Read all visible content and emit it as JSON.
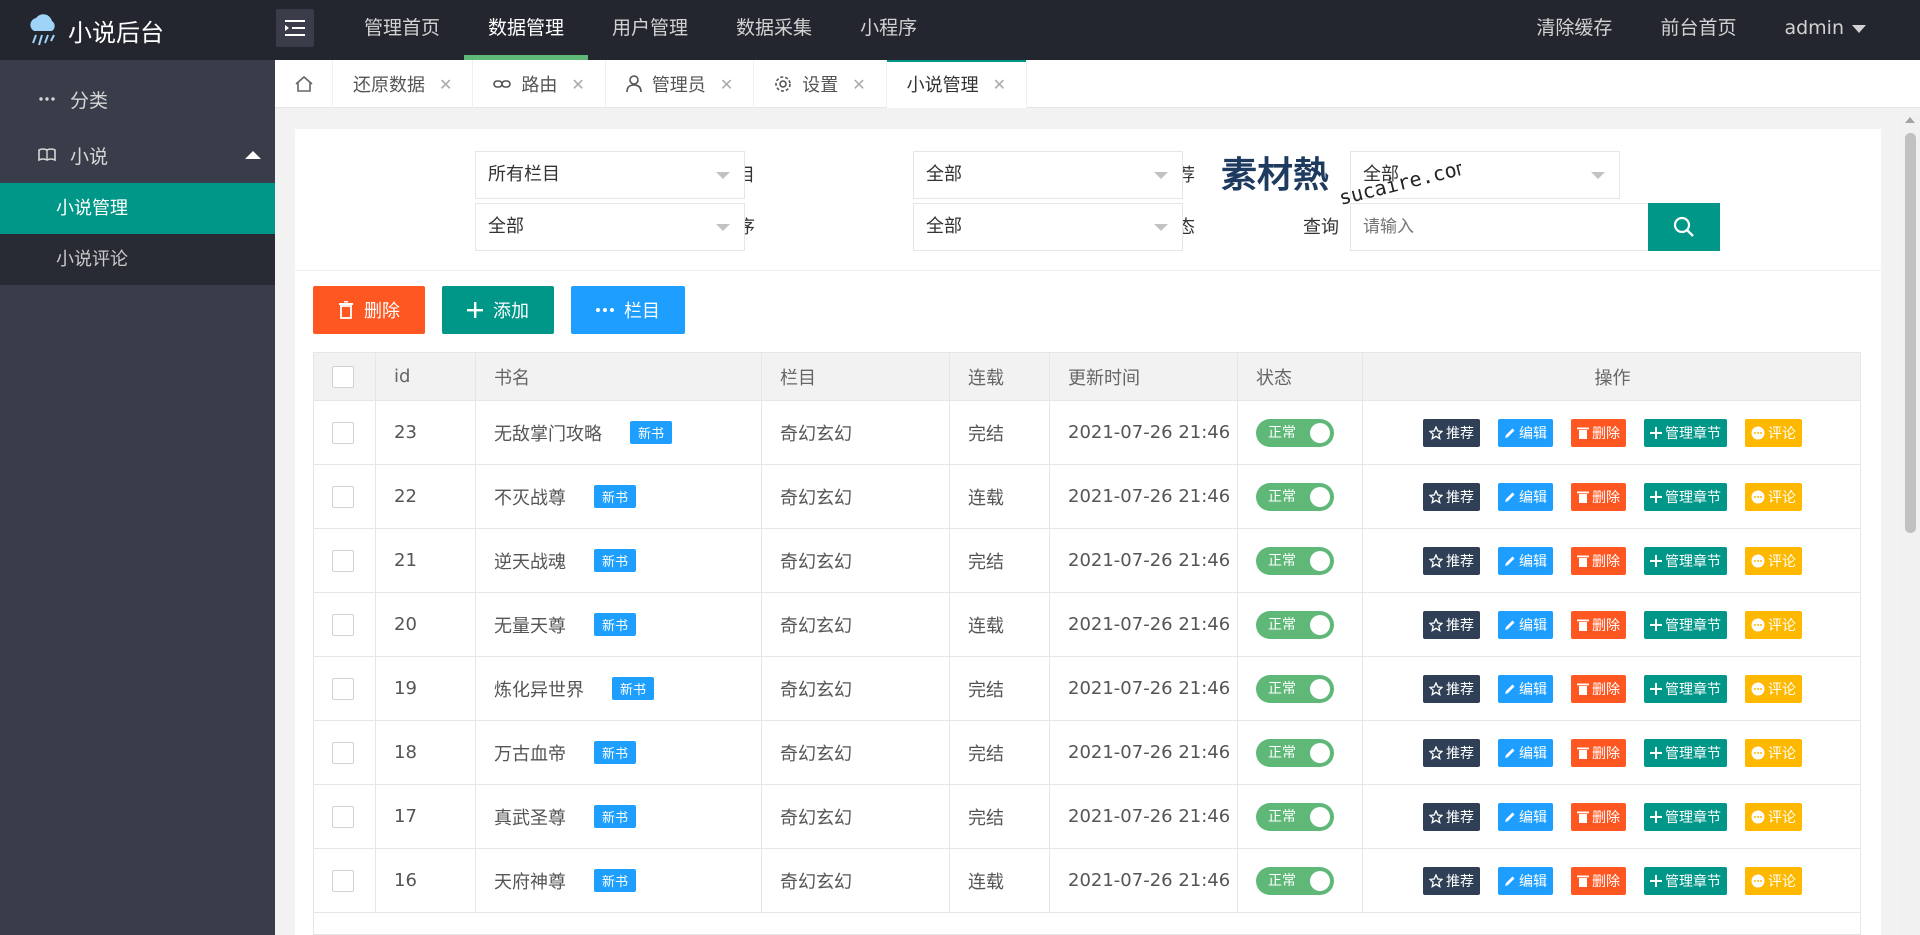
{
  "header": {
    "logo_text": "小说后台",
    "nav": [
      "管理首页",
      "数据管理",
      "用户管理",
      "数据采集",
      "小程序"
    ],
    "active_nav": 1,
    "right_links": [
      "清除缓存",
      "前台首页"
    ],
    "user": "admin"
  },
  "sidebar": {
    "category": "分类",
    "novel_group": "小说",
    "sub_items": [
      "小说管理",
      "小说评论"
    ]
  },
  "tabs": [
    "还原数据",
    "路由",
    "管理员",
    "设置",
    "小说管理"
  ],
  "filters": {
    "column_label": "栏目",
    "column_value": "所有栏目",
    "recommend_label": "推荐",
    "recommend_value": "全部",
    "sort_label": "排序",
    "sort_value": "全部",
    "status_label": "状态",
    "status_value": "全部",
    "type_value": "全部",
    "query_label": "查询",
    "query_placeholder": "请输入"
  },
  "watermark": {
    "brand": "素材熱",
    "domain": "sucaire.com"
  },
  "actions": {
    "delete": "删除",
    "add": "添加",
    "column": "栏目"
  },
  "table": {
    "headers": [
      "id",
      "书名",
      "栏目",
      "连载",
      "更新时间",
      "状态",
      "操作"
    ],
    "badge": "新书",
    "status_on": "正常",
    "ops": {
      "recommend": "推荐",
      "edit": "编辑",
      "delete": "删除",
      "chapters": "管理章节",
      "comment": "评论"
    },
    "rows": [
      {
        "id": "23",
        "name": "无敌掌门攻略",
        "column": "奇幻玄幻",
        "serial": "完结",
        "time": "2021-07-26 21:46"
      },
      {
        "id": "22",
        "name": "不灭战尊",
        "column": "奇幻玄幻",
        "serial": "连载",
        "time": "2021-07-26 21:46"
      },
      {
        "id": "21",
        "name": "逆天战魂",
        "column": "奇幻玄幻",
        "serial": "完结",
        "time": "2021-07-26 21:46"
      },
      {
        "id": "20",
        "name": "无量天尊",
        "column": "奇幻玄幻",
        "serial": "连载",
        "time": "2021-07-26 21:46"
      },
      {
        "id": "19",
        "name": "炼化异世界",
        "column": "奇幻玄幻",
        "serial": "完结",
        "time": "2021-07-26 21:46"
      },
      {
        "id": "18",
        "name": "万古血帝",
        "column": "奇幻玄幻",
        "serial": "完结",
        "time": "2021-07-26 21:46"
      },
      {
        "id": "17",
        "name": "真武圣尊",
        "column": "奇幻玄幻",
        "serial": "完结",
        "time": "2021-07-26 21:46"
      },
      {
        "id": "16",
        "name": "天府神尊",
        "column": "奇幻玄幻",
        "serial": "连载",
        "time": "2021-07-26 21:46"
      }
    ]
  }
}
